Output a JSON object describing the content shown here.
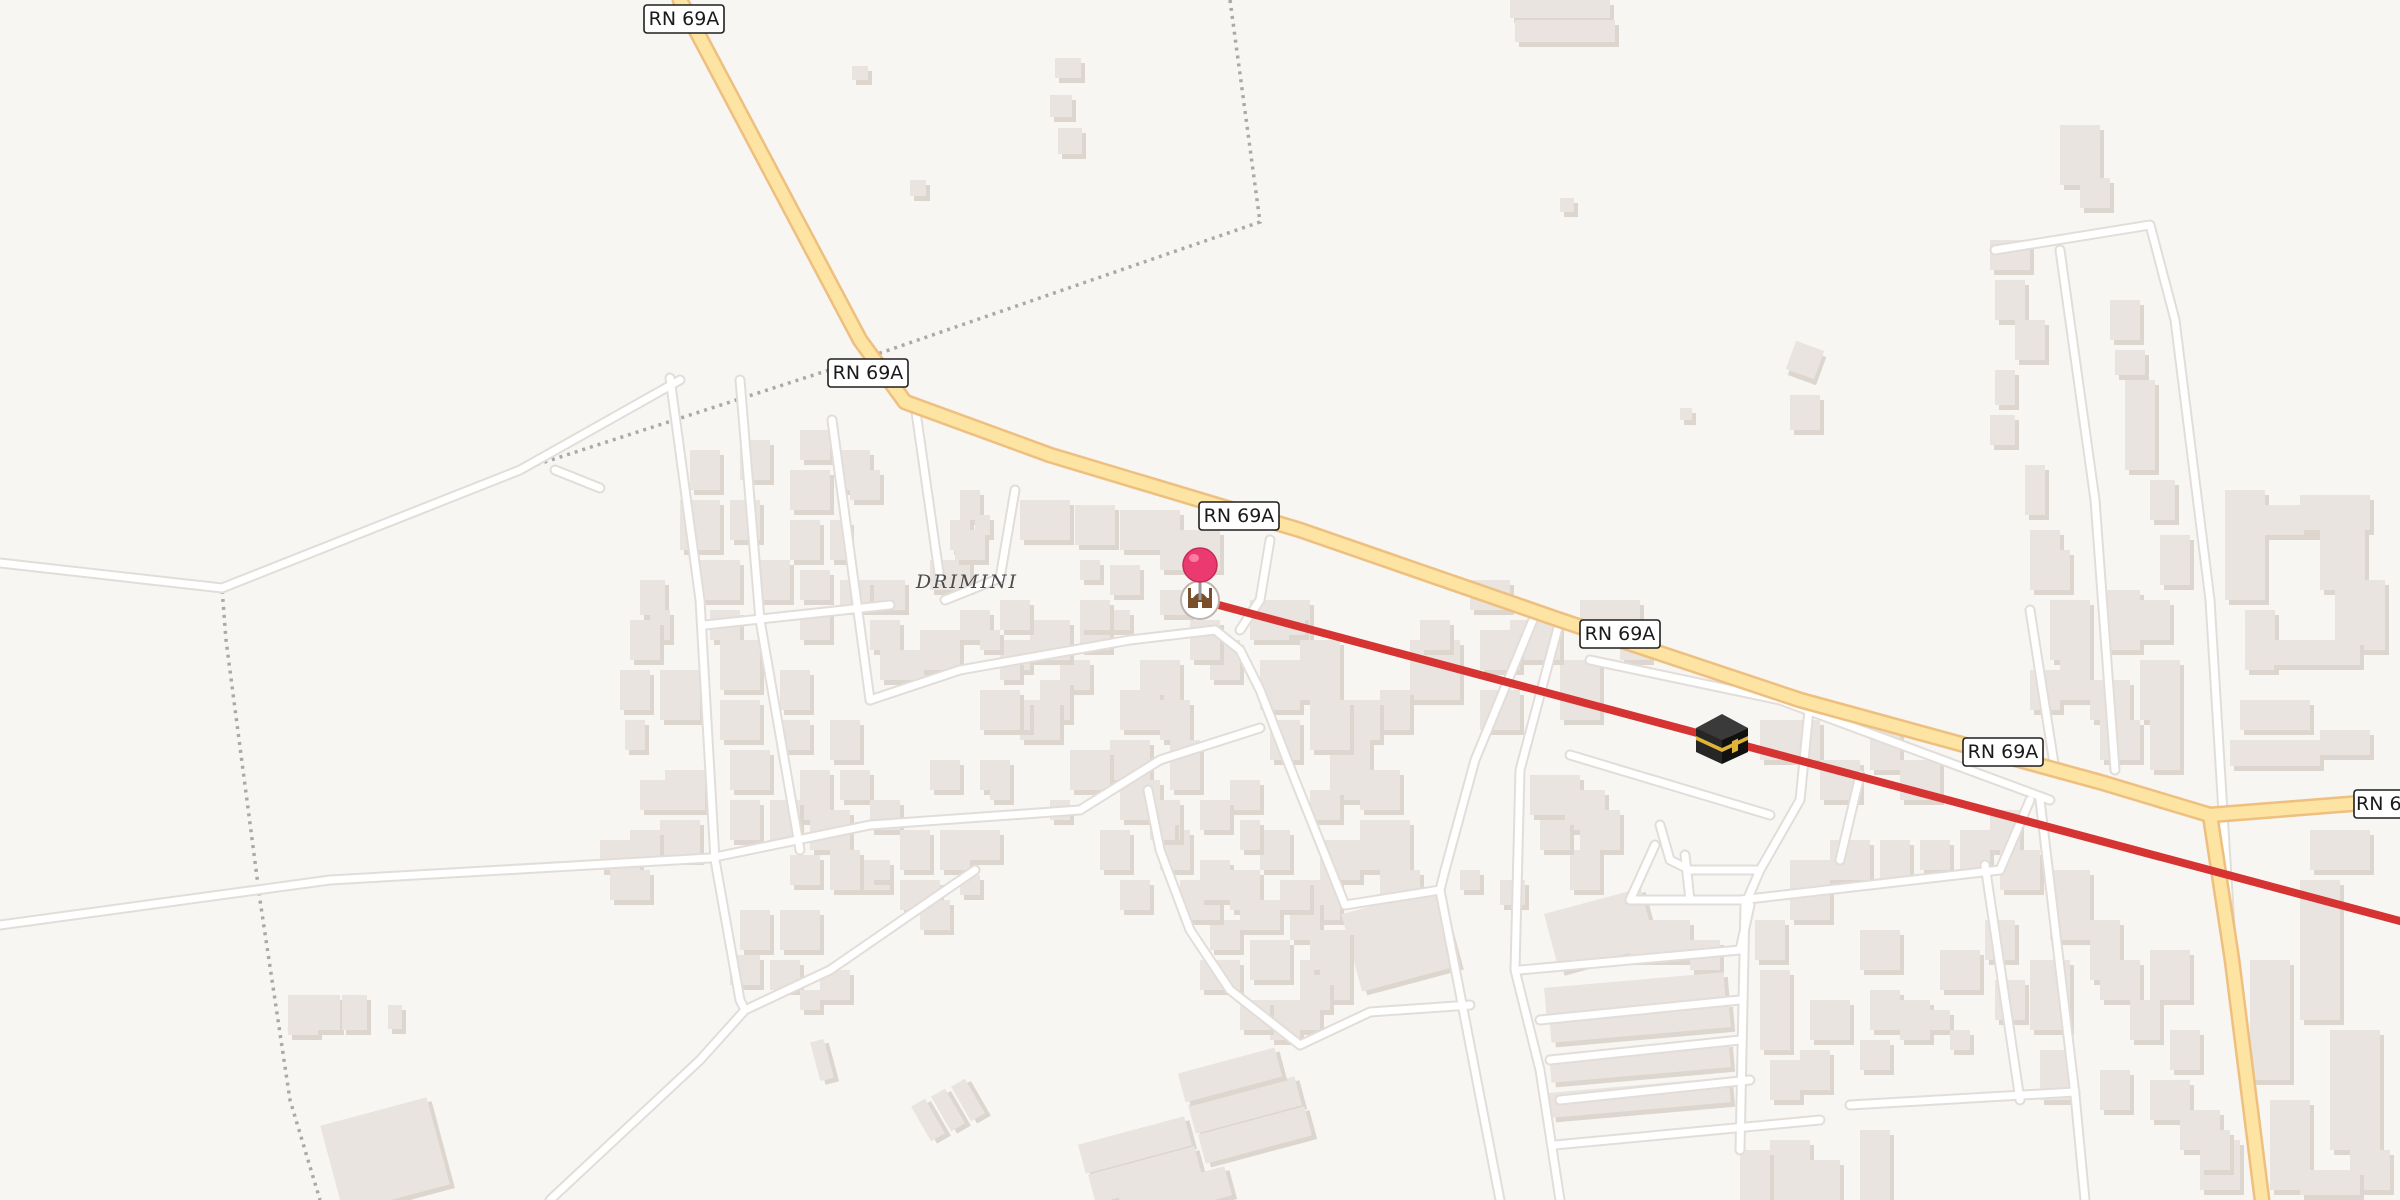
{
  "map": {
    "place_label": "DRIMINI",
    "road_labels": [
      "RN 69A",
      "RN 69A",
      "RN 69A",
      "RN 69A",
      "RN 69A",
      "RN 6"
    ],
    "markers": [
      {
        "name": "pin-marker",
        "icon": "map-pin-icon",
        "color": "#ea3a6f"
      },
      {
        "name": "mosque-poi",
        "icon": "mosque-icon"
      },
      {
        "name": "kaaba-destination",
        "icon": "kaaba-icon"
      }
    ],
    "route": {
      "name": "qibla-direction-line",
      "color": "#d63333"
    },
    "colors": {
      "background": "#f8f6f3",
      "building": "#e9e4df",
      "building_edge": "#ddd6cf",
      "minor_road": "#ffffff",
      "minor_road_casing": "#e2ddd8",
      "primary_road": "#fde4a3",
      "primary_road_casing": "#eebf7e",
      "boundary": "#a9a9a9"
    }
  }
}
